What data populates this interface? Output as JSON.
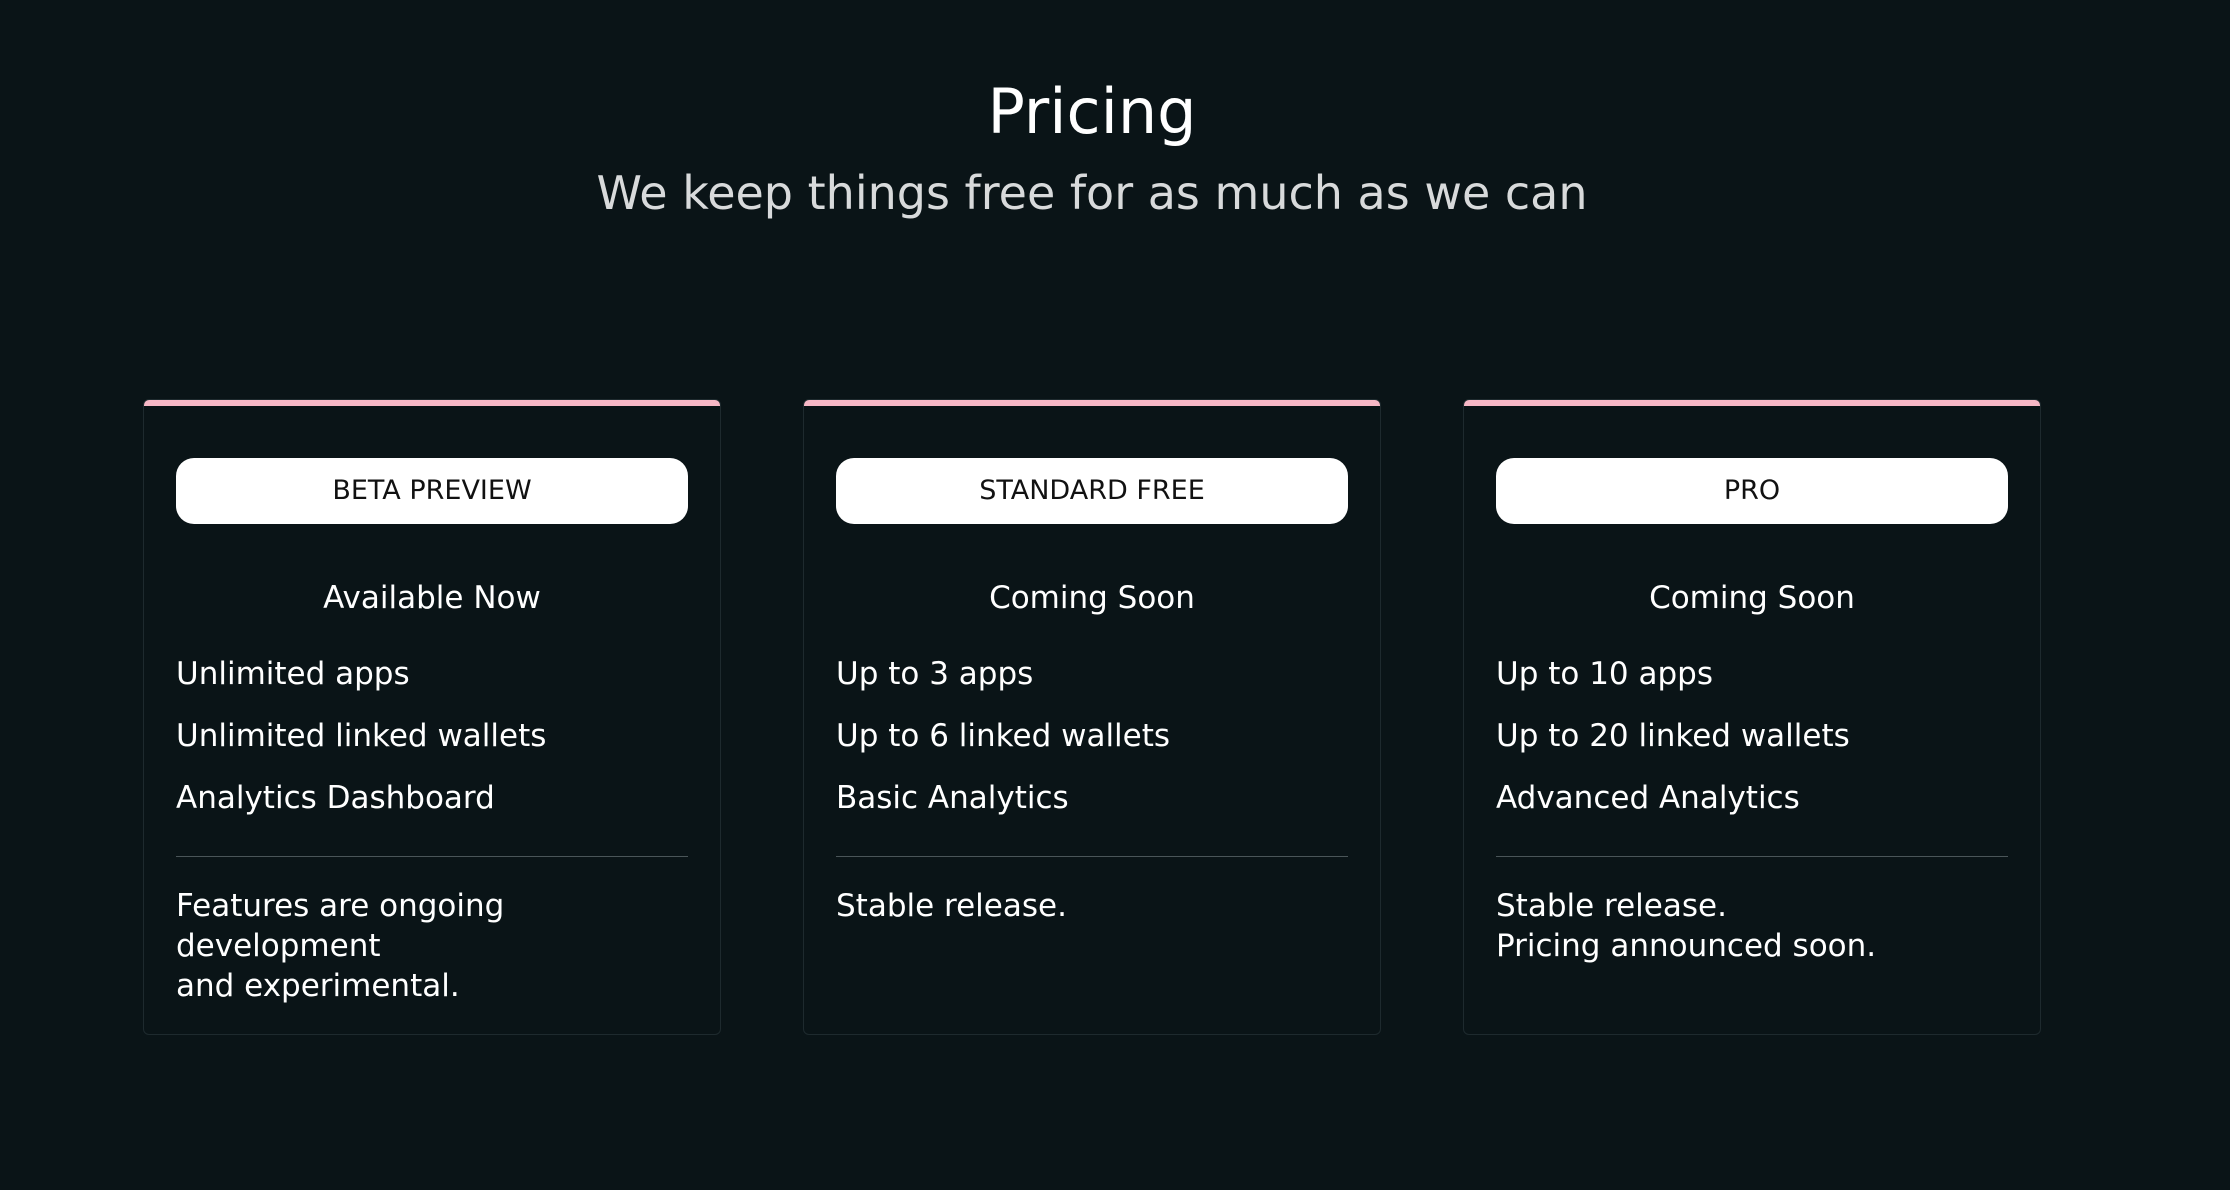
{
  "header": {
    "title": "Pricing",
    "subtitle": "We keep things free for as much as we can"
  },
  "colors": {
    "background": "#0a1417",
    "card_accent": "#f7b8c6",
    "pill_background": "#ffffff",
    "text": "#ffffff"
  },
  "plans": [
    {
      "label": "BETA PREVIEW",
      "availability": "Available Now",
      "features": [
        "Unlimited apps",
        "Unlimited linked wallets",
        "Analytics Dashboard"
      ],
      "note_lines": [
        "Features are ongoing development",
        "and experimental."
      ]
    },
    {
      "label": "STANDARD FREE",
      "availability": "Coming Soon",
      "features": [
        "Up to 3 apps",
        "Up to 6 linked wallets",
        "Basic Analytics"
      ],
      "note_lines": [
        "Stable release."
      ]
    },
    {
      "label": "PRO",
      "availability": "Coming Soon",
      "features": [
        "Up to 10 apps",
        "Up to 20 linked wallets",
        "Advanced Analytics"
      ],
      "note_lines": [
        "Stable release.",
        "Pricing announced soon."
      ]
    }
  ]
}
